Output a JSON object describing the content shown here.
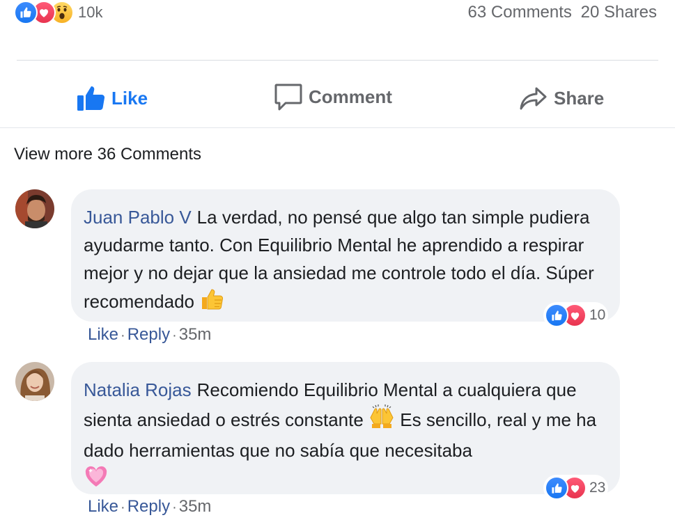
{
  "post_stats": {
    "reaction_count": "10k",
    "comments_count": "63 Comments",
    "shares_count": "20 Shares",
    "reaction_icons": [
      "like-icon",
      "love-icon",
      "wow-icon"
    ]
  },
  "actions": {
    "like": "Like",
    "comment": "Comment",
    "share": "Share"
  },
  "view_more": "View more 36 Comments",
  "comments": [
    {
      "author": "Juan Pablo V",
      "text_before_emoji": "La verdad, no pensé que algo tan simple pudiera ayudarme tanto. Con Equilibrio Mental he aprendido a respirar mejor y no dejar que la ansiedad me controle todo el día. Súper recomendado",
      "emoji": "thumbs-up",
      "reaction_count": "10",
      "like": "Like",
      "reply": "Reply",
      "time": "35m"
    },
    {
      "author": "Natalia Rojas",
      "text_before_emoji": "Recomiendo Equilibrio Mental a cualquiera que sienta ansiedad o estrés constante",
      "emoji": "raising-hands",
      "text_after_emoji": "Es sencillo, real y me ha dado herramientas que no sabía que necesitaba",
      "end_emoji": "sparkling-heart",
      "reaction_count": "23",
      "like": "Like",
      "reply": "Reply",
      "time": "35m"
    }
  ],
  "colors": {
    "brand_blue": "#1877f2",
    "name_blue": "#385898",
    "gray_text": "#65676b",
    "bubble_bg": "#f0f2f5"
  }
}
